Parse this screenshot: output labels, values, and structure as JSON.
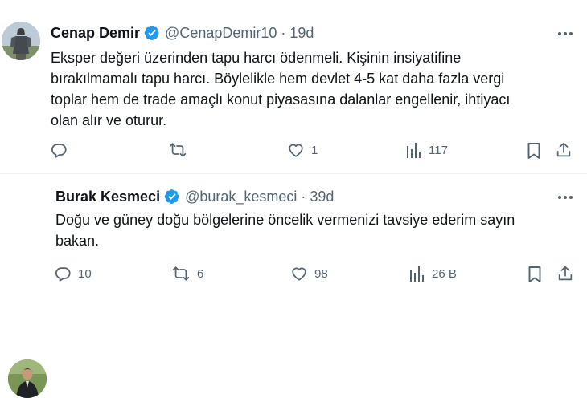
{
  "tweets": [
    {
      "name": "Cenap Demir",
      "handle": "@CenapDemir10",
      "separator": "·",
      "time": "19d",
      "text": "Eksper değeri üzerinden tapu harcı ödenmeli. Kişinin insiyatifine\nbırakılmamalı tapu harcı. Böylelikle hem devlet 4-5 kat daha fazla vergi\ntoplar hem de trade amaçlı konut piyasasına dalanlar engellenir, ihtiyacı\nolan alır ve oturur.",
      "replies": "",
      "retweets": "",
      "likes": "1",
      "views": "117"
    },
    {
      "name": "Burak Kesmeci",
      "handle": "@burak_kesmeci",
      "separator": "·",
      "time": "39d",
      "text": "Doğu ve güney doğu bölgelerine öncelik vermenizi tavsiye ederim sayın\nbakan.",
      "replies": "10",
      "retweets": "6",
      "likes": "98",
      "views": "26 B"
    }
  ],
  "colors": {
    "verified": "#1d9bf0",
    "secondary_text": "#536471",
    "primary_text": "#0f1419",
    "divider": "#eff3f4"
  },
  "icons": [
    "more-icon",
    "verified-badge-icon",
    "reply-icon",
    "retweet-icon",
    "like-icon",
    "views-icon",
    "bookmark-icon",
    "share-icon"
  ]
}
